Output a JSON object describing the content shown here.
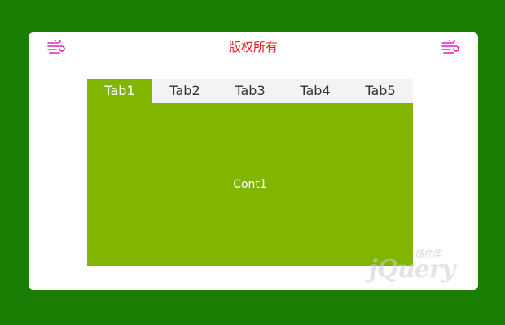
{
  "header": {
    "title": "版权所有",
    "left_icon": "wind-icon",
    "right_icon": "wind-icon",
    "icon_color": "#e020c0",
    "title_color": "#e8161c"
  },
  "tabs": {
    "items": [
      {
        "label": "Tab1",
        "active": true
      },
      {
        "label": "Tab2",
        "active": false
      },
      {
        "label": "Tab3",
        "active": false
      },
      {
        "label": "Tab4",
        "active": false
      },
      {
        "label": "Tab5",
        "active": false
      }
    ],
    "active_color": "#82b500",
    "inactive_bg": "#f3f3f3"
  },
  "panel": {
    "content": "Cont1"
  },
  "watermark": {
    "cn_text": "插件库",
    "en_text": "jQuery"
  },
  "colors": {
    "page_background": "#1a7d04",
    "card_background": "#ffffff"
  }
}
